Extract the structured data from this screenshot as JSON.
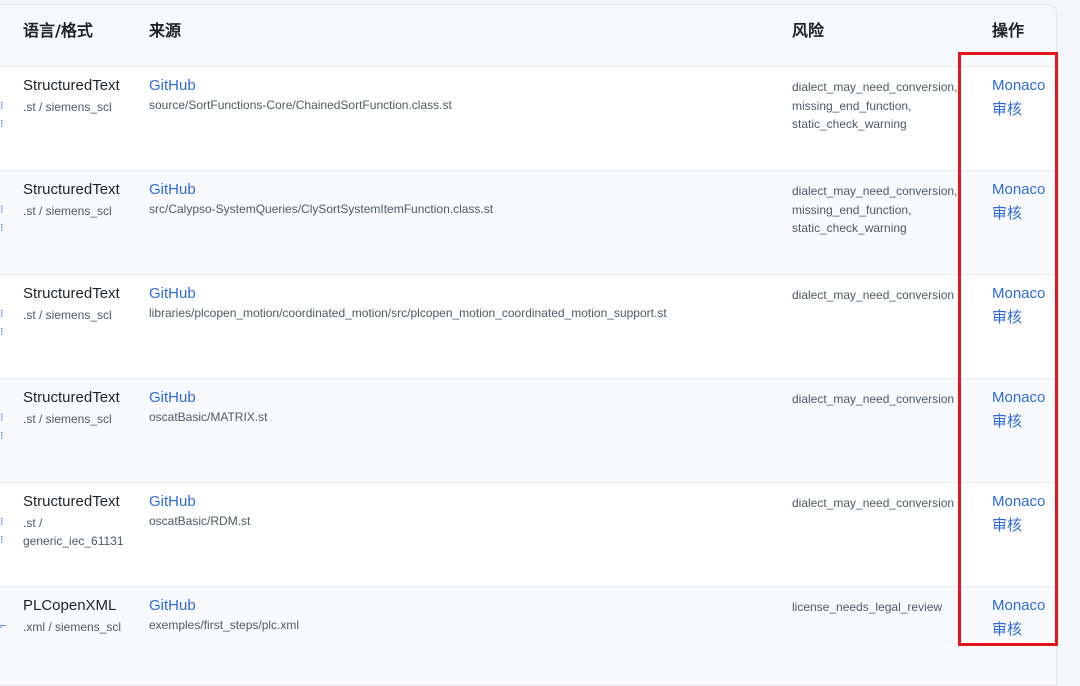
{
  "table": {
    "headers": {
      "lang": "语言/格式",
      "source": "来源",
      "risk": "风险",
      "action": "操作"
    },
    "rows": [
      {
        "lang": "StructuredText",
        "format": ".st / siemens_scl",
        "source": "GitHub",
        "path": "source/SortFunctions-Core/ChainedSortFunction.class.st",
        "risks": [
          "dialect_may_need_conversion,",
          "missing_end_function,",
          "static_check_warning"
        ],
        "action_monaco": "Monaco",
        "action_review": "审核"
      },
      {
        "lang": "StructuredText",
        "format": ".st / siemens_scl",
        "source": "GitHub",
        "path": "src/Calypso-SystemQueries/ClySortSystemItemFunction.class.st",
        "risks": [
          "dialect_may_need_conversion,",
          "missing_end_function,",
          "static_check_warning"
        ],
        "action_monaco": "Monaco",
        "action_review": "审核"
      },
      {
        "lang": "StructuredText",
        "format": ".st / siemens_scl",
        "source": "GitHub",
        "path": "libraries/plcopen_motion/coordinated_motion/src/plcopen_motion_coordinated_motion_support.st",
        "risks": [
          "dialect_may_need_conversion"
        ],
        "action_monaco": "Monaco",
        "action_review": "审核"
      },
      {
        "lang": "StructuredText",
        "format": ".st / siemens_scl",
        "source": "GitHub",
        "path": "oscatBasic/MATRIX.st",
        "risks": [
          "dialect_may_need_conversion"
        ],
        "action_monaco": "Monaco",
        "action_review": "审核"
      },
      {
        "lang": "StructuredText",
        "format": ".st / generic_iec_61131",
        "source": "GitHub",
        "path": "oscatBasic/RDM.st",
        "risks": [
          "dialect_may_need_conversion"
        ],
        "action_monaco": "Monaco",
        "action_review": "审核"
      },
      {
        "lang": "PLCopenXML",
        "format": ".xml / siemens_scl",
        "source": "GitHub",
        "path": "exemples/first_steps/plc.xml",
        "risks": [
          "license_needs_legal_review"
        ],
        "action_monaco": "Monaco",
        "action_review": "审核"
      }
    ]
  },
  "colors": {
    "link": "#2f6bd8",
    "highlight_border": "#e0161c",
    "header_bg": "#f6f8fb"
  }
}
